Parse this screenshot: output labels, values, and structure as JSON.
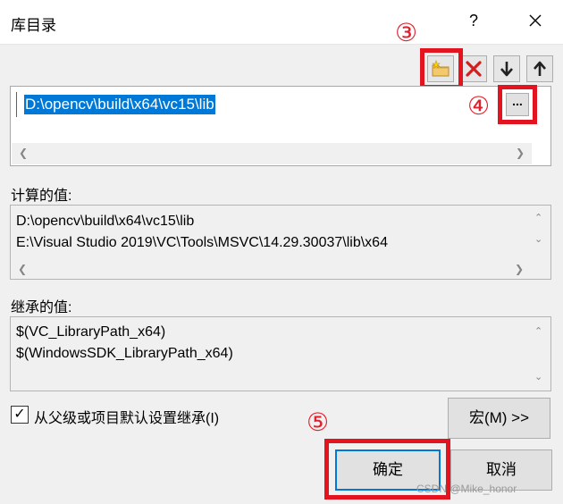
{
  "window": {
    "title": "库目录",
    "help_label": "?"
  },
  "annotations": {
    "step3": "③",
    "step4": "④",
    "step5": "⑤"
  },
  "toolbar": {
    "new_line_icon": "new-folder-icon",
    "delete_icon": "delete-icon",
    "move_down_icon": "arrow-down-icon",
    "move_up_icon": "arrow-up-icon"
  },
  "directories": {
    "items": [
      "D:\\opencv\\build\\x64\\vc15\\lib"
    ],
    "browse_label": "..."
  },
  "computed": {
    "label": "计算的值:",
    "lines": [
      "D:\\opencv\\build\\x64\\vc15\\lib",
      "E:\\Visual Studio 2019\\VC\\Tools\\MSVC\\14.29.30037\\lib\\x64"
    ]
  },
  "inherited": {
    "label": "继承的值:",
    "lines": [
      "$(VC_LibraryPath_x64)",
      "$(WindowsSDK_LibraryPath_x64)"
    ]
  },
  "inherit_checkbox": {
    "label": "从父级或项目默认设置继承(I)",
    "checked": true,
    "check_glyph": "✓"
  },
  "buttons": {
    "macros": "宏(M) >>",
    "ok": "确定",
    "cancel": "取消"
  },
  "watermark": "CSDN @Mike_honor",
  "colors": {
    "selection": "#0078d7",
    "annotation_red": "#e3131f",
    "delete_red": "#d41e1e"
  }
}
